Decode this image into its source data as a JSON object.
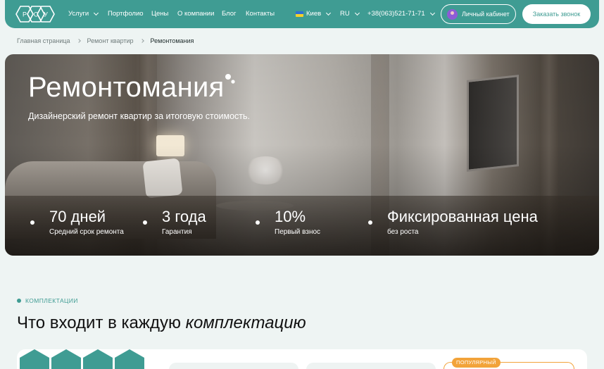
{
  "header": {
    "logo_letters": [
      "Р",
      "С",
      "У"
    ],
    "nav": [
      {
        "label": "Услуги",
        "has_dropdown": true
      },
      {
        "label": "Портфолио"
      },
      {
        "label": "Цены"
      },
      {
        "label": "О компании"
      },
      {
        "label": "Блог"
      },
      {
        "label": "Контакты"
      }
    ],
    "city": "Киев",
    "language": "RU",
    "phone": "+38(063)521-71-71",
    "cabinet_label": "Личный кабинет",
    "callback_label": "Заказать звонок"
  },
  "breadcrumbs": [
    "Главная страница",
    "Ремонт квартир",
    "Ремонтомания"
  ],
  "hero": {
    "title": "Ремонтомания",
    "subtitle": "Дизайнерский ремонт квартир за итоговую стоимость.",
    "stats": [
      {
        "value": "70 дней",
        "label": "Средний срок ремонта"
      },
      {
        "value": "3 года",
        "label": "Гарантия"
      },
      {
        "value": "10%",
        "label": "Первый взнос"
      },
      {
        "value": "Фиксированная цена",
        "label": "без роста"
      }
    ]
  },
  "section": {
    "tag": "КОМПЛЕКТАЦИИ",
    "title_plain": "Что входит в каждую",
    "title_italic": "комплектацию",
    "popular_badge": "ПОПУЛЯРНЫЙ"
  },
  "colors": {
    "accent": "#3f9c93",
    "badge": "#f2a33a",
    "background": "#eef4f3"
  }
}
